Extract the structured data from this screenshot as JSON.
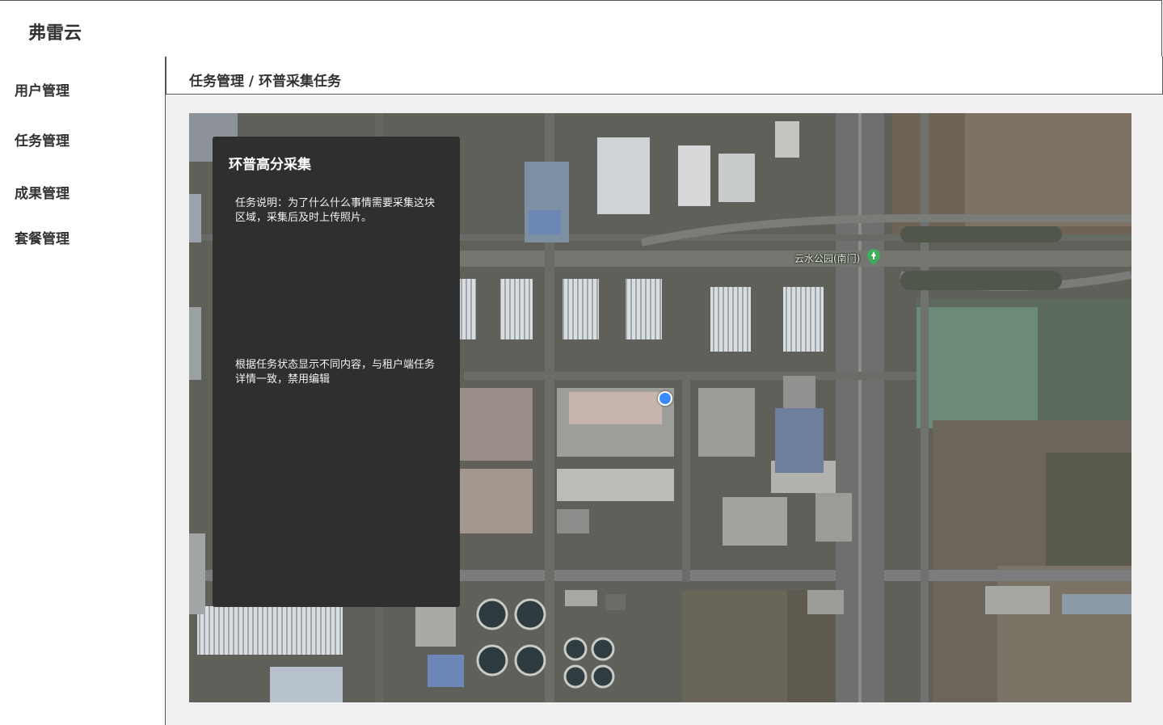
{
  "app": {
    "brand": "弗雷云"
  },
  "sidebar": {
    "items": [
      {
        "label": "用户管理"
      },
      {
        "label": "任务管理"
      },
      {
        "label": "成果管理"
      },
      {
        "label": "套餐管理"
      }
    ]
  },
  "breadcrumb": {
    "text": "任务管理 / 环普采集任务"
  },
  "task_panel": {
    "title": "环普高分采集",
    "description": "任务说明：为了什么什么事情需要采集这块区域，采集后及时上传照片。",
    "note": "根据任务状态显示不同内容，与租户端任务详情一致，禁用编辑"
  },
  "map": {
    "poi_label": "云水公园(南门)",
    "poi_icon": "park-pin-icon",
    "location_icon": "current-location-icon",
    "colors": {
      "panel_bg": "#2f2f2f",
      "location_dot": "#3a8bff",
      "poi_pin": "#3fae5a"
    }
  }
}
